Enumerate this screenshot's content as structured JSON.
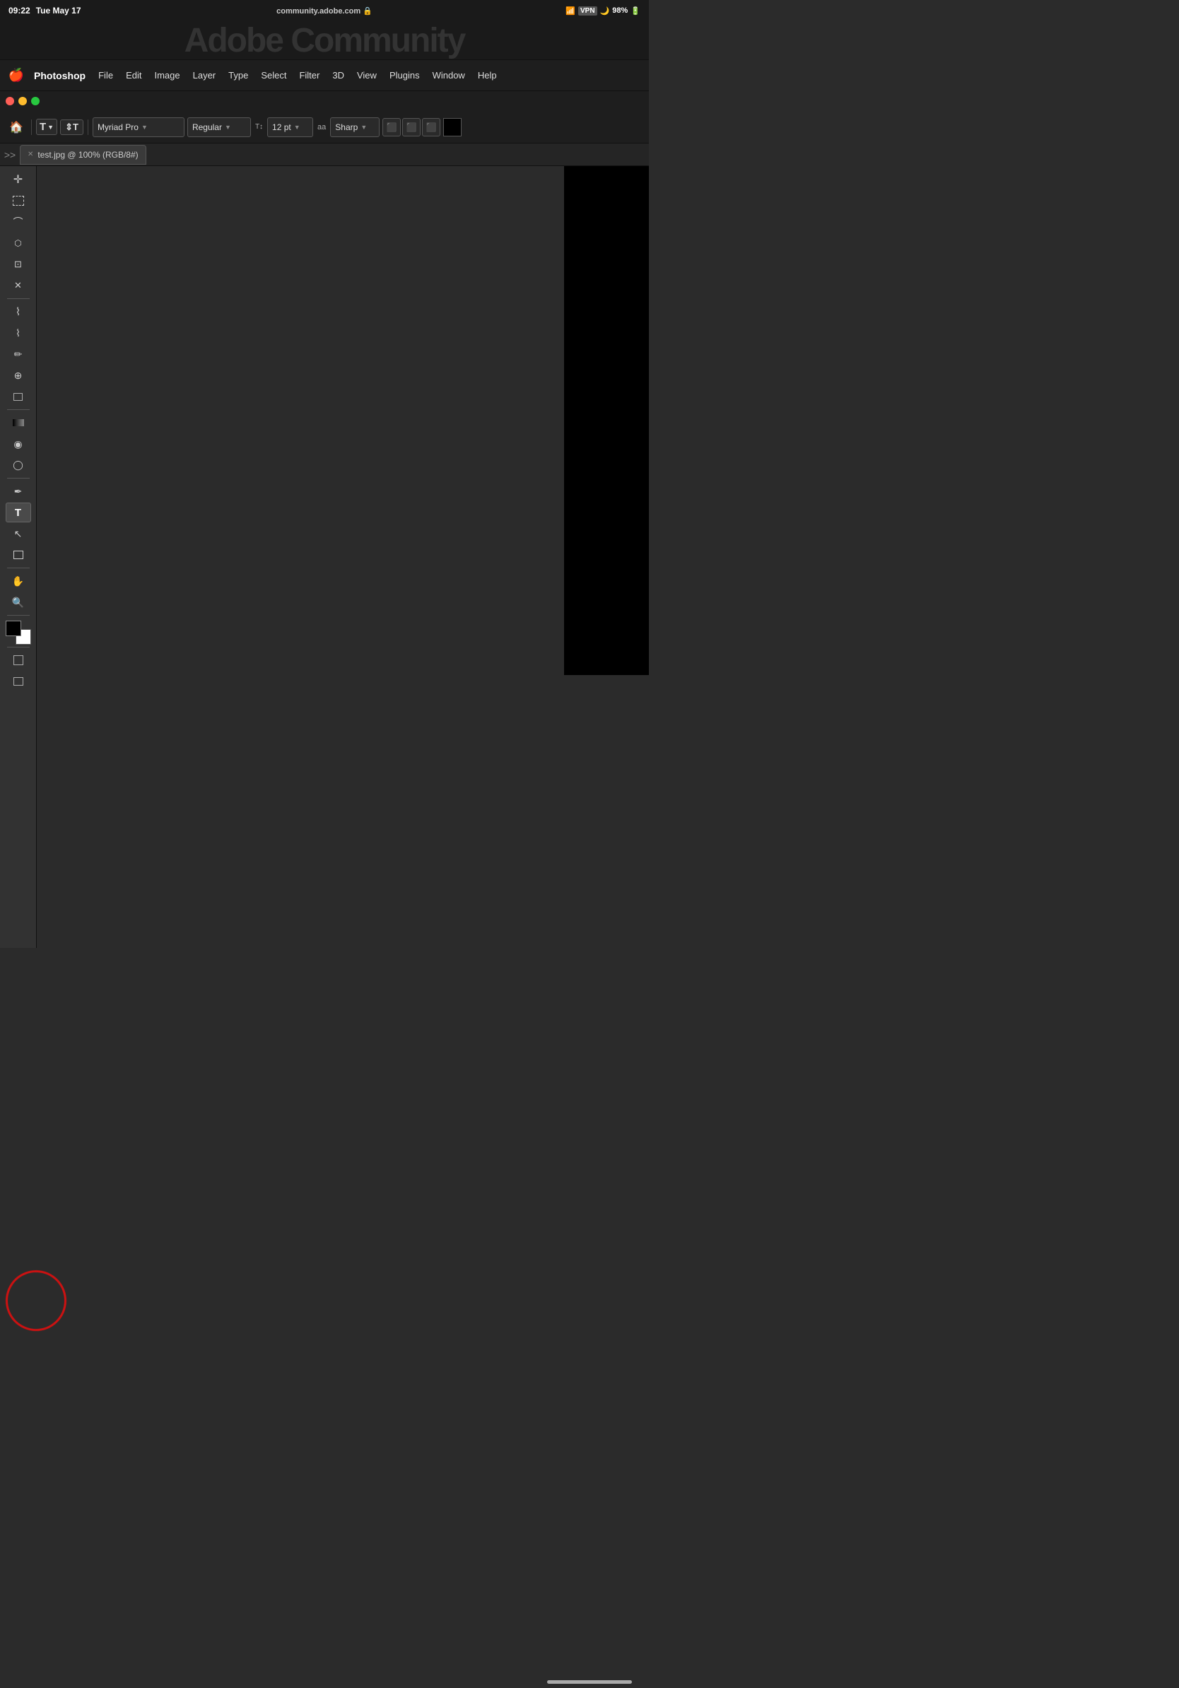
{
  "statusBar": {
    "time": "09:22",
    "date": "Tue May 17",
    "url": "community.adobe.com",
    "wifi": "📶",
    "vpn": "VPN",
    "battery": "98%"
  },
  "menuBar": {
    "appName": "Photoshop",
    "items": [
      "File",
      "Edit",
      "Image",
      "Layer",
      "Type",
      "Select",
      "Filter",
      "3D",
      "View",
      "Plugins",
      "Window",
      "Help"
    ]
  },
  "toolbar": {
    "fontName": "Myriad Pro",
    "fontStyle": "Regular",
    "fontSize": "12 pt",
    "antialiasing": "Sharp",
    "alignLeft": "≡",
    "alignCenter": "≡",
    "alignRight": "≡"
  },
  "tab": {
    "name": "test.jpg @ 100% (RGB/8#)"
  },
  "tools": [
    {
      "name": "move-tool",
      "icon": "✛",
      "label": "Move Tool"
    },
    {
      "name": "marquee-tool",
      "icon": "⬜",
      "label": "Marquee Tool"
    },
    {
      "name": "lasso-tool",
      "icon": "⌒",
      "label": "Lasso Tool"
    },
    {
      "name": "crop-tool-poly",
      "icon": "⬡",
      "label": "Polygonal Lasso"
    },
    {
      "name": "crop-tool",
      "icon": "⊡",
      "label": "Crop Tool"
    },
    {
      "name": "slice-tool",
      "icon": "✕",
      "label": "Slice Tool"
    },
    {
      "name": "eyedropper-tool",
      "icon": "⌇",
      "label": "Eyedropper"
    },
    {
      "name": "brush-tool",
      "icon": "⌇",
      "label": "Brush Tool"
    },
    {
      "name": "pencil-tool",
      "icon": "/",
      "label": "Pencil"
    },
    {
      "name": "clone-tool",
      "icon": "♟",
      "label": "Clone Stamp"
    },
    {
      "name": "eraser-tool",
      "icon": "◻",
      "label": "Eraser"
    },
    {
      "name": "gradient-tool",
      "icon": "⬛",
      "label": "Gradient Tool"
    },
    {
      "name": "blur-tool",
      "icon": "◉",
      "label": "Blur Tool"
    },
    {
      "name": "dodge-tool",
      "icon": "◯",
      "label": "Dodge Tool"
    },
    {
      "name": "pen-tool",
      "icon": "✒",
      "label": "Pen Tool"
    },
    {
      "name": "type-tool",
      "icon": "T",
      "label": "Type Tool"
    },
    {
      "name": "path-selection",
      "icon": "↖",
      "label": "Path Selection"
    },
    {
      "name": "shape-tool",
      "icon": "⬜",
      "label": "Shape Tool"
    },
    {
      "name": "hand-tool",
      "icon": "✋",
      "label": "Hand Tool"
    },
    {
      "name": "zoom-tool",
      "icon": "🔍",
      "label": "Zoom Tool"
    }
  ],
  "colors": {
    "foreground": "#000000",
    "background": "#ffffff"
  },
  "adobeHeader": "Adobe Community"
}
